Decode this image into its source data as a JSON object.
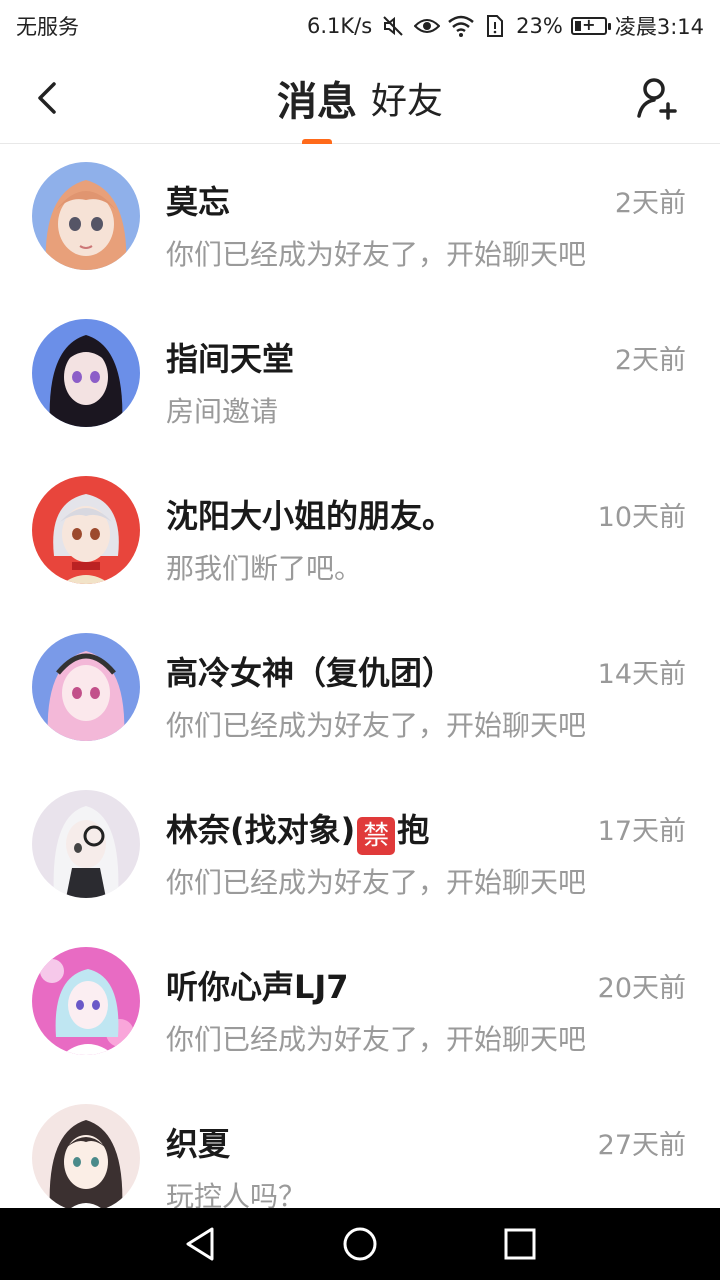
{
  "status_bar": {
    "carrier": "无服务",
    "speed": "6.1K/s",
    "battery": "23%",
    "battery_level": 0.23,
    "time": "凌晨3:14",
    "icons": [
      "mute-icon",
      "eye-icon",
      "wifi-icon",
      "sim-icon",
      "battery-icon"
    ]
  },
  "header": {
    "tab_messages": "消息",
    "tab_friends": "好友",
    "active_tab": "消息",
    "accent": "#ff6a1a"
  },
  "conversations": [
    {
      "name": "莫忘",
      "time": "2天前",
      "preview": "你们已经成为好友了，开始聊天吧",
      "avatar_bg": "#8fb0ea"
    },
    {
      "name": "指间天堂",
      "time": "2天前",
      "preview": "房间邀请",
      "avatar_bg": "#6b8fe8"
    },
    {
      "name": "沈阳大小姐的朋友。",
      "time": "10天前",
      "preview": "那我们断了吧。",
      "avatar_bg": "#e8453c"
    },
    {
      "name_before": "高冷女神（复仇团）",
      "time": "14天前",
      "preview": "你们已经成为好友了，开始聊天吧",
      "avatar_bg": "#7a9ae8"
    },
    {
      "name_before": "林奈(找对象)",
      "badge": "禁",
      "name_after": "抱",
      "time": "17天前",
      "preview": "你们已经成为好友了，开始聊天吧",
      "avatar_bg": "#e9e3ec"
    },
    {
      "name": "听你心声LJ7",
      "time": "20天前",
      "preview": "你们已经成为好友了，开始聊天吧",
      "avatar_bg": "#e86bc3"
    },
    {
      "name": "织夏",
      "time": "27天前",
      "preview": "玩控人吗？",
      "avatar_bg": "#f4e6e4"
    }
  ],
  "nav": {
    "icons": [
      "back-triangle-icon",
      "home-circle-icon",
      "recents-square-icon"
    ]
  }
}
